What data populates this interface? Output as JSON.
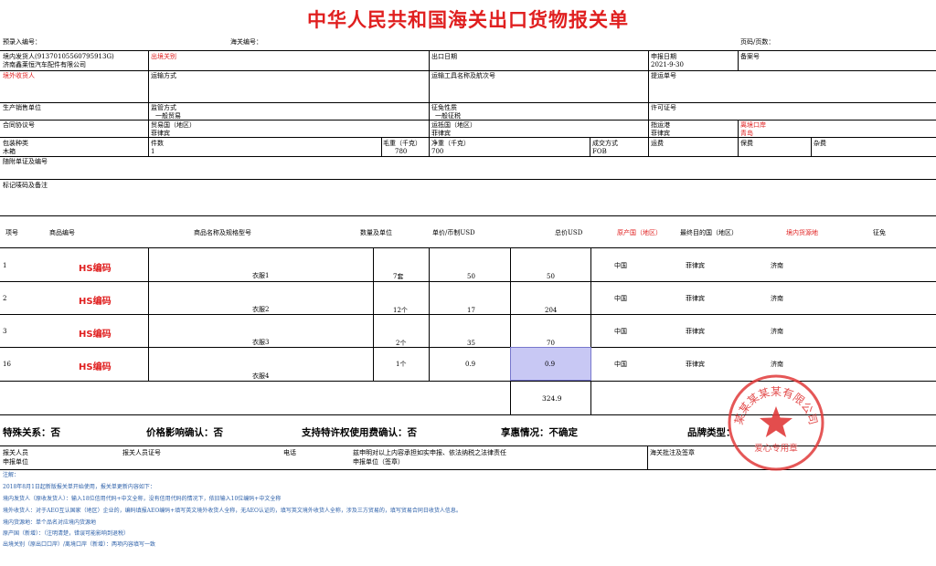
{
  "title": "中华人民共和国海关出口货物报关单",
  "header": {
    "preentry_label": "预录入编号：",
    "customs_no_label": "海关编号：",
    "page_label": "页码/页数："
  },
  "row1": {
    "shipper_label": "境内发货人(91370105560795913G)",
    "shipper_value": "济南鑫莱恒汽车配件有限公司",
    "exit_customs_label": "出境关别",
    "export_date_label": "出口日期",
    "declare_date_label": "申报日期",
    "declare_date_value": "2021-9-30",
    "record_no_label": "备案号"
  },
  "row2": {
    "consignee_label": "境外收货人",
    "transport_mode_label": "运输方式",
    "vehicle_label": "运输工具名称及航次号",
    "bill_no_label": "提运单号"
  },
  "row3": {
    "producer_label": "生产销售单位",
    "supervision_label": "监管方式",
    "supervision_value": "一般贸易",
    "levy_label": "征免性质",
    "levy_value": "一般征税",
    "license_label": "许可证号"
  },
  "row4": {
    "contract_label": "合同协议号",
    "trade_country_label": "贸易国（地区）",
    "trade_country_value": "菲律宾",
    "dest_country_label": "运抵国（地区）",
    "dest_country_value": "菲律宾",
    "port_label": "指运港",
    "port_value": "菲律宾",
    "exit_port_label": "离境口岸",
    "exit_port_value": "青岛"
  },
  "row5": {
    "package_label": "包装种类",
    "package_value": "木箱",
    "pieces_label": "件数",
    "pieces_value": "1",
    "gross_label": "毛重（千克）",
    "gross_value": "780",
    "net_label": "净重（千克）",
    "net_value": "700",
    "deal_label": "成交方式",
    "deal_value": "FOB",
    "freight_label": "运费",
    "insurance_label": "保费",
    "misc_label": "杂费"
  },
  "row6": {
    "docs_label": "随附单证及编号"
  },
  "row7": {
    "marks_label": "标记唛码及备注"
  },
  "goods_header": {
    "no": "项号",
    "code": "商品编号",
    "name": "商品名称及规格型号",
    "qty": "数量及单位",
    "price": "单价/币制USD",
    "total": "总价USD",
    "origin": "原产国（地区）",
    "final_dest": "最终目的国（地区）",
    "source": "境内货源地",
    "exempt": "征免"
  },
  "goods": [
    {
      "no": "1",
      "code": "HS编码",
      "name": "衣服1",
      "qty": "7套",
      "price": "50",
      "total": "50",
      "origin": "中国",
      "dest": "菲律宾",
      "source": "济南"
    },
    {
      "no": "2",
      "code": "HS编码",
      "name": "衣服2",
      "qty": "12个",
      "price": "17",
      "total": "204",
      "origin": "中国",
      "dest": "菲律宾",
      "source": "济南"
    },
    {
      "no": "3",
      "code": "HS编码",
      "name": "衣服3",
      "qty": "2个",
      "price": "35",
      "total": "70",
      "origin": "中国",
      "dest": "菲律宾",
      "source": "济南"
    },
    {
      "no": "16",
      "code": "HS编码",
      "name": "衣服4",
      "qty": "1个",
      "price": "0.9",
      "total": "0.9",
      "origin": "中国",
      "dest": "菲律宾",
      "source": "济南"
    }
  ],
  "grand_total": "324.9",
  "confirm": {
    "special": "特殊关系：否",
    "price_effect": "价格影响确认：否",
    "royalty": "支持特许权使用费确认：否",
    "preference": "享惠情况：不确定",
    "brand": "品牌类型："
  },
  "footer": {
    "declarant": "报关人员",
    "declare_unit": "申报单位",
    "declarant_cert": "报关人员证号",
    "phone": "电话",
    "statement": "兹申明对以上内容承担如实申报、依法纳税之法律责任",
    "unit_seal": "申报单位（签章）",
    "customs_remark": "海关批注及签章"
  },
  "notes": [
    "注解：",
    "2018年8月1日起新版报关单开始使用，报关单更新内容如下：",
    "境内发货人（原收发货人）：输入18位信用代码+中文全称，没有信用代码的情况下，依旧输入10位编码+中文全称",
    "境外收货人：对于AEO互认国家（地区）企业的，编码填报AEO编码+填写英文境外收货人全称，无AEO认证的，填写英文境外收货人全称，涉及三方贸易的，填写贸易合同日收货人信息。",
    "境内货源地：单个品名对应境内货源地",
    "原产国（新增）：（注明清楚，错误可能影响到退税）",
    "出境关别（原出口口岸）/离境口岸（新增）：两项内容填写一致"
  ],
  "stamp": {
    "ring_text": "某某某某某有限公司",
    "bottom_text": "爱心专用章",
    "color": "#e03a3a"
  },
  "colors": {
    "accent_red": "#e02020",
    "highlight": "#c8c8f4",
    "note_blue": "#2a5ea8"
  }
}
